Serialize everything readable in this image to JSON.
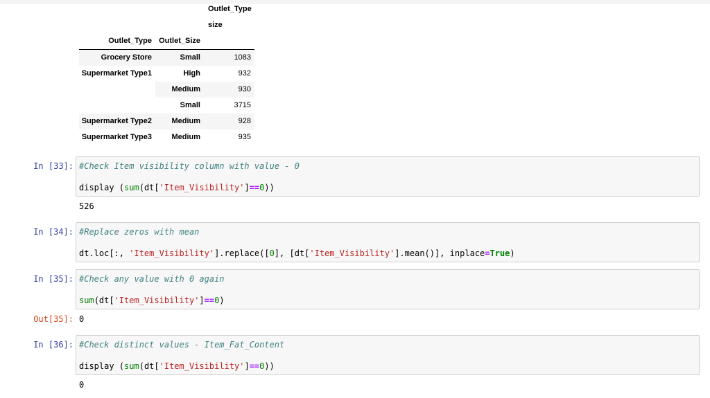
{
  "dataframe": {
    "column_header": "Outlet_Type",
    "value_label": "size",
    "index_names": [
      "Outlet_Type",
      "Outlet_Size"
    ],
    "rows": [
      {
        "outlet_type": "Grocery Store",
        "outlet_size": "Small",
        "value": "1083"
      },
      {
        "outlet_type": "Supermarket Type1",
        "outlet_size": "High",
        "value": "932"
      },
      {
        "outlet_type": "",
        "outlet_size": "Medium",
        "value": "930"
      },
      {
        "outlet_type": "",
        "outlet_size": "Small",
        "value": "3715"
      },
      {
        "outlet_type": "Supermarket Type2",
        "outlet_size": "Medium",
        "value": "928"
      },
      {
        "outlet_type": "Supermarket Type3",
        "outlet_size": "Medium",
        "value": "935"
      }
    ]
  },
  "cells": [
    {
      "prompt": "In [33]:",
      "comment": "#Check Item visibility column with value - 0",
      "code_tokens": [
        {
          "t": "display (",
          "c": ""
        },
        {
          "t": "sum",
          "c": "bi"
        },
        {
          "t": "(dt[",
          "c": ""
        },
        {
          "t": "'Item_Visibility'",
          "c": "str"
        },
        {
          "t": "]",
          "c": ""
        },
        {
          "t": "==",
          "c": "op"
        },
        {
          "t": "0",
          "c": "nm"
        },
        {
          "t": "))",
          "c": ""
        }
      ],
      "out_prompt": "",
      "output": "526"
    },
    {
      "prompt": "In [34]:",
      "comment": "#Replace zeros with mean",
      "code_tokens": [
        {
          "t": "dt.loc[:, ",
          "c": ""
        },
        {
          "t": "'Item_Visibility'",
          "c": "str"
        },
        {
          "t": "].replace([",
          "c": ""
        },
        {
          "t": "0",
          "c": "nm"
        },
        {
          "t": "], [dt[",
          "c": ""
        },
        {
          "t": "'Item_Visibility'",
          "c": "str"
        },
        {
          "t": "].mean()], inplace",
          "c": ""
        },
        {
          "t": "=",
          "c": "op"
        },
        {
          "t": "True",
          "c": "kw"
        },
        {
          "t": ")",
          "c": ""
        }
      ],
      "out_prompt": "",
      "output": ""
    },
    {
      "prompt": "In [35]:",
      "comment": "#Check any value with 0 again",
      "code_tokens": [
        {
          "t": "sum",
          "c": "bi"
        },
        {
          "t": "(dt[",
          "c": ""
        },
        {
          "t": "'Item_Visibility'",
          "c": "str"
        },
        {
          "t": "]",
          "c": ""
        },
        {
          "t": "==",
          "c": "op"
        },
        {
          "t": "0",
          "c": "nm"
        },
        {
          "t": ")",
          "c": ""
        }
      ],
      "out_prompt": "Out[35]:",
      "output": "0"
    },
    {
      "prompt": "In [36]:",
      "comment": "#Check distinct values - Item_Fat_Content",
      "code_tokens": [
        {
          "t": "display (",
          "c": ""
        },
        {
          "t": "sum",
          "c": "bi"
        },
        {
          "t": "(dt[",
          "c": ""
        },
        {
          "t": "'Item_Visibility'",
          "c": "str"
        },
        {
          "t": "]",
          "c": ""
        },
        {
          "t": "==",
          "c": "op"
        },
        {
          "t": "0",
          "c": "nm"
        },
        {
          "t": "))",
          "c": ""
        }
      ],
      "out_prompt": "",
      "output": "0"
    }
  ],
  "colors": {
    "prompt_in": "#303f9f",
    "prompt_out": "#d84315",
    "comment": "#408080",
    "string": "#ba2121",
    "builtin": "#008000",
    "operator": "#aa22ff"
  }
}
